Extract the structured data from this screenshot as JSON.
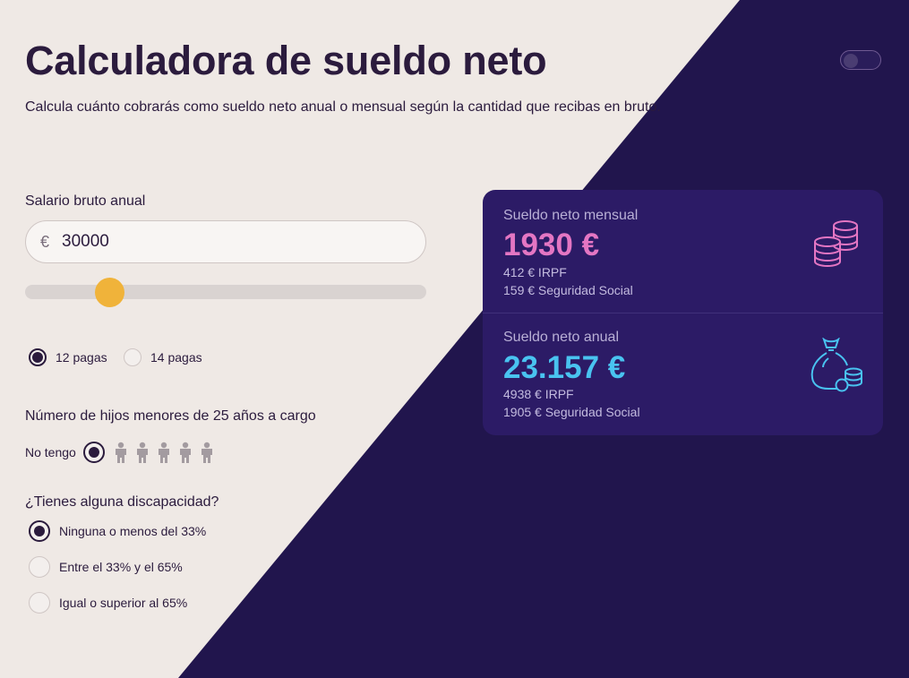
{
  "header": {
    "title": "Calculadora de sueldo neto",
    "subtitle": "Calcula cuánto cobrarás como sueldo neto anual o mensual según la cantidad que recibas en bruto."
  },
  "theme_toggle": {
    "state": "off"
  },
  "salary": {
    "label": "Salario bruto anual",
    "currency_symbol": "€",
    "value": "30000",
    "slider_level": 0.2
  },
  "payments": {
    "options": [
      "12 pagas",
      "14 pagas"
    ],
    "selected": "12 pagas"
  },
  "children": {
    "label": "Número de hijos menores de 25 años a cargo",
    "none_label": "No tengo",
    "selected": 0,
    "max_icons": 5
  },
  "disability": {
    "label": "¿Tienes alguna discapacidad?",
    "options": [
      "Ninguna o menos del 33%",
      "Entre el 33% y el 65%",
      "Igual o superior al 65%"
    ],
    "selected": "Ninguna o menos del 33%"
  },
  "results": {
    "monthly": {
      "label": "Sueldo neto mensual",
      "value": "1930 €",
      "irpf": "412 € IRPF",
      "ss": "159 € Seguridad Social",
      "icon": "coins-icon"
    },
    "annual": {
      "label": "Sueldo neto anual",
      "value": "23.157 €",
      "irpf": "4938 € IRPF",
      "ss": "1905 € Seguridad Social",
      "icon": "money-bag-icon"
    }
  },
  "colors": {
    "background_light": "#efe9e5",
    "background_dark": "#21154d",
    "card": "#2c1b66",
    "accent_slider": "#f0b33a",
    "monthly_value": "#e476c3",
    "annual_value": "#49c3f0",
    "text_dark": "#2b1b3d"
  }
}
